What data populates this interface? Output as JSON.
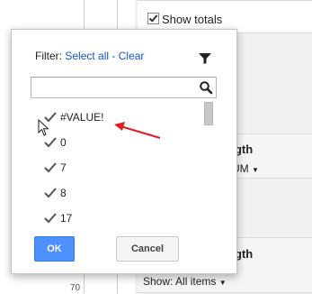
{
  "background": {
    "show_totals_label": "Show totals",
    "ngth_label_1": "ngth",
    "um_dropdown": "UM",
    "ngth_label_2": "ngth",
    "show_dropdown": "Show: All items",
    "bottom_stub": "70"
  },
  "filter_popup": {
    "filter_label": "Filter:",
    "select_all_label": "Select all",
    "separator": "-",
    "clear_label": "Clear",
    "search_value": "",
    "values": [
      {
        "label": "#VALUE!",
        "checked": true
      },
      {
        "label": "0",
        "checked": true
      },
      {
        "label": "7",
        "checked": true
      },
      {
        "label": "8",
        "checked": true
      },
      {
        "label": "17",
        "checked": true
      }
    ],
    "ok_label": "OK",
    "cancel_label": "Cancel"
  },
  "colors": {
    "link": "#1155cc",
    "primary_button": "#4d90fe",
    "annotation_arrow": "#e02020"
  },
  "icons": {
    "filter": "filter-funnel-icon",
    "search": "search-icon",
    "check": "checkmark-icon",
    "cursor": "mouse-pointer-icon"
  }
}
